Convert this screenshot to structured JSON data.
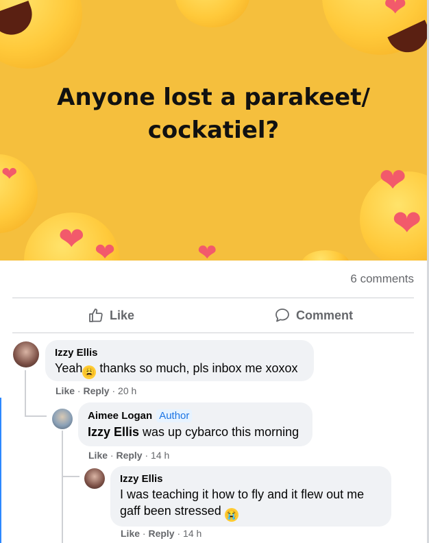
{
  "post": {
    "banner_text": "Anyone lost a parakeet/ cockatiel?",
    "banner_line1": "Anyone lost a parakeet/",
    "banner_line2": "cockatiel?",
    "comments_count": "6 comments",
    "like_label": "Like",
    "comment_label": "Comment"
  },
  "comments": [
    {
      "author": "Izzy Ellis",
      "text_before": "Yeah",
      "emoji": "tired-face-emoji",
      "text_after": " thanks so much, pls inbox me xoxox",
      "like": "Like",
      "reply": "Reply",
      "time": "20 h"
    },
    {
      "author": "Aimee Logan",
      "badge": "Author",
      "mention": "Izzy Ellis",
      "text": " was up cybarco this morning",
      "like": "Like",
      "reply": "Reply",
      "time": "14 h"
    },
    {
      "author": "Izzy Ellis",
      "text_line1": "I was teaching it how to fly and it flew out me",
      "text_line2": "gaff been stressed",
      "emoji": "crying-face-emoji",
      "like": "Like",
      "reply": "Reply",
      "time": "14 h"
    }
  ],
  "icons": {
    "like": "thumbs-up-icon",
    "comment": "speech-bubble-icon"
  },
  "colors": {
    "banner": "#f5bf3d",
    "muted": "#65676b",
    "bubble": "#f0f2f5",
    "author_badge": "#1b74e4"
  }
}
